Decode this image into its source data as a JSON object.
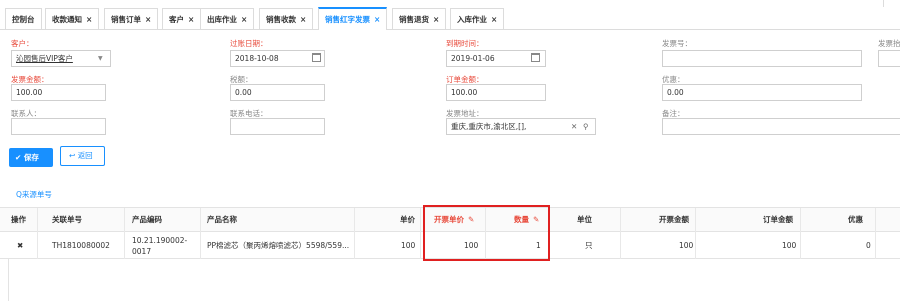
{
  "tabs": [
    {
      "label": "控制台",
      "closable": false
    },
    {
      "label": "收款通知",
      "closable": true
    },
    {
      "label": "销售订单",
      "closable": true
    },
    {
      "label": "客户",
      "closable": true
    },
    {
      "label": "出库作业",
      "closable": true
    },
    {
      "label": "销售收款",
      "closable": true
    },
    {
      "label": "销售红字发票",
      "closable": true,
      "active": true
    },
    {
      "label": "销售退货",
      "closable": true
    },
    {
      "label": "入库作业",
      "closable": true
    }
  ],
  "close_glyph": "×",
  "form": {
    "customer_label": "客户：",
    "customer_value": "沁园售后VIP客户",
    "due_date_label": "过账日期：",
    "due_date_value": "2018-10-08",
    "arrival_label": "到期时间：",
    "arrival_value": "2019-01-06",
    "invoice_no_label": "发票号：",
    "invoice_type_label": "发票抬",
    "invoice_amount_label": "发票金额：",
    "invoice_amount_value": "100.00",
    "tax_label": "税额：",
    "tax_value": "0.00",
    "order_amount_label": "订单金额：",
    "order_amount_value": "100.00",
    "discount_label": "优惠：",
    "discount_value": "0.00",
    "contact_label": "联系人：",
    "phone_label": "联系电话：",
    "address_label": "发票地址：",
    "address_value": "重庆,重庆市,渝北区,[],",
    "remark_label": "备注："
  },
  "buttons": {
    "save": "保存",
    "back": "返回",
    "source": "Q来源单号"
  },
  "table": {
    "headers": {
      "op": "操作",
      "ref_no": "关联单号",
      "code": "产品编码",
      "name": "产品名称",
      "price": "单价",
      "invoice_price": "开票单价",
      "qty": "数量",
      "unit": "单位",
      "invoice_amount": "开票金额",
      "order_amount": "订单金额",
      "discount": "优惠"
    },
    "rows": [
      {
        "op": "✖",
        "ref_no": "TH1810080002",
        "code": "10.21.190002-0017",
        "name": "PP棉滤芯（聚丙烯熔喷滤芯）5598/559...",
        "price": "100",
        "invoice_price": "100",
        "qty": "1",
        "unit": "只",
        "invoice_amount": "100",
        "order_amount": "100",
        "discount": "0"
      }
    ]
  }
}
